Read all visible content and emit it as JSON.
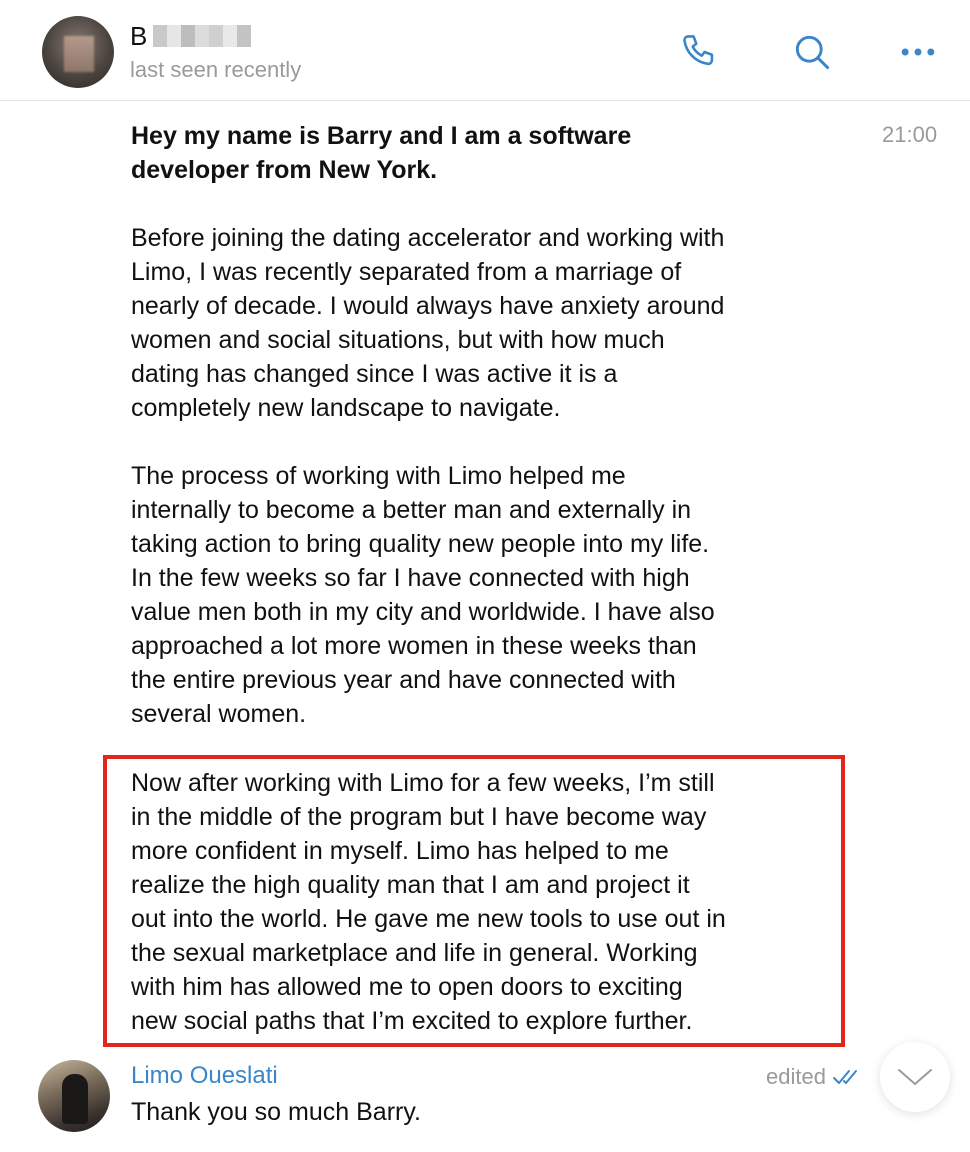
{
  "header": {
    "contact_initial": "B",
    "contact_status": "last seen recently",
    "icons": [
      "phone-icon",
      "search-icon",
      "more-icon"
    ],
    "accent_color": "#3a86c8"
  },
  "message": {
    "time": "21:00",
    "intro_bold": "Hey my name is Barry and I am a software\ndeveloper from New York.",
    "paragraph_1": "Before joining the dating accelerator and working with\nLimo, I was recently separated from a marriage of\nnearly of decade. I would always have anxiety around\nwomen and social situations, but with how much\ndating has changed since I was active it is a\ncompletely new landscape to navigate.",
    "paragraph_2": "The process of working with Limo helped me\ninternally to become a better man and externally in\ntaking action to bring quality new people into my life.\nIn the few weeks so far I have connected with high\nvalue men both in my city and worldwide. I have also\napproached a lot more women in these weeks than\nthe entire previous year and have connected with\nseveral women.",
    "paragraph_3_highlighted": "Now after working with Limo for a few weeks, I’m still\nin the middle of the program but I have become way\nmore confident in myself. Limo has helped to me\nrealize the high quality man that I am and project it\nout into the world. He gave me new tools to use out in\nthe sexual marketplace and life in general. Working\nwith him has allowed me to open doors to exciting\nnew social paths that I’m excited to explore further.",
    "highlight_color": "#e3261b"
  },
  "reply": {
    "author": "Limo Oueslati",
    "text": "Thank you so much Barry.",
    "status": "edited"
  }
}
